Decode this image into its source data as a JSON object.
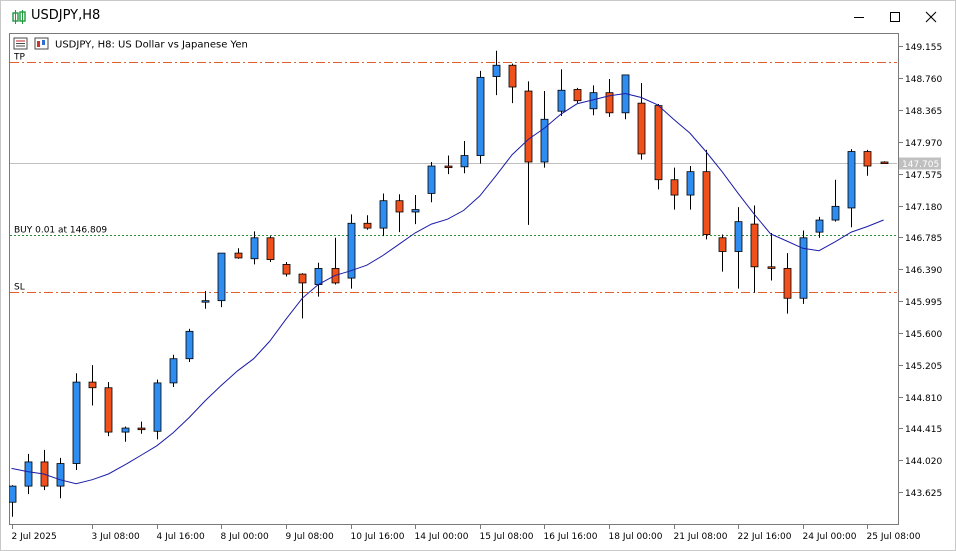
{
  "window": {
    "title": "USDJPY,H8"
  },
  "chart_header": {
    "text": "USDJPY, H8:  US Dollar vs Japanese Yen"
  },
  "levels": {
    "tp_label": "TP",
    "tp_price": 148.96,
    "buy_label": "BUY 0.01 at 146.809",
    "buy_price": 146.809,
    "sl_label": "SL",
    "sl_price": 146.11,
    "current_price_label": "147.705",
    "current_price": 147.705
  },
  "colors": {
    "bull": "#2f8cf0",
    "bear": "#f0501c",
    "ma": "#1c1ca8",
    "tp_sl_line": "#e0602a",
    "buy_line": "#2e8b3a",
    "grid": "#e8e8e8"
  },
  "chart_data": {
    "type": "candlestick",
    "symbol": "USDJPY",
    "timeframe": "H8",
    "ylim": [
      143.23,
      149.32
    ],
    "y_ticks": [
      "149.155",
      "148.760",
      "148.365",
      "147.970",
      "147.575",
      "147.180",
      "146.785",
      "146.390",
      "145.995",
      "145.600",
      "145.205",
      "144.810",
      "144.415",
      "144.020",
      "143.625"
    ],
    "x_ticks": [
      {
        "index": 0,
        "label": "2 Jul 2025"
      },
      {
        "index": 5,
        "label": "3 Jul 08:00"
      },
      {
        "index": 9,
        "label": "4 Jul 16:00"
      },
      {
        "index": 13,
        "label": "8 Jul 00:00"
      },
      {
        "index": 17,
        "label": "9 Jul 08:00"
      },
      {
        "index": 21,
        "label": "10 Jul 16:00"
      },
      {
        "index": 25,
        "label": "14 Jul 00:00"
      },
      {
        "index": 29,
        "label": "15 Jul 08:00"
      },
      {
        "index": 33,
        "label": "16 Jul 16:00"
      },
      {
        "index": 37,
        "label": "18 Jul 00:00"
      },
      {
        "index": 41,
        "label": "21 Jul 08:00"
      },
      {
        "index": 45,
        "label": "22 Jul 16:00"
      },
      {
        "index": 49,
        "label": "24 Jul 00:00"
      },
      {
        "index": 53,
        "label": "25 Jul 08:00"
      }
    ],
    "candles": [
      {
        "o": 143.5,
        "h": 143.71,
        "l": 143.32,
        "c": 143.7
      },
      {
        "o": 143.7,
        "h": 144.1,
        "l": 143.6,
        "c": 144.0
      },
      {
        "o": 144.0,
        "h": 144.15,
        "l": 143.65,
        "c": 143.7
      },
      {
        "o": 143.7,
        "h": 144.05,
        "l": 143.55,
        "c": 143.98
      },
      {
        "o": 143.98,
        "h": 145.1,
        "l": 143.9,
        "c": 144.99
      },
      {
        "o": 144.99,
        "h": 145.2,
        "l": 144.7,
        "c": 144.92
      },
      {
        "o": 144.92,
        "h": 144.99,
        "l": 144.32,
        "c": 144.37
      },
      {
        "o": 144.37,
        "h": 144.44,
        "l": 144.25,
        "c": 144.42
      },
      {
        "o": 144.42,
        "h": 144.5,
        "l": 144.35,
        "c": 144.4
      },
      {
        "o": 144.38,
        "h": 145.02,
        "l": 144.28,
        "c": 144.98
      },
      {
        "o": 144.98,
        "h": 145.33,
        "l": 144.93,
        "c": 145.28
      },
      {
        "o": 145.28,
        "h": 145.65,
        "l": 145.24,
        "c": 145.62
      },
      {
        "o": 145.99,
        "h": 146.12,
        "l": 145.9,
        "c": 146.0
      },
      {
        "o": 146.0,
        "h": 146.4,
        "l": 145.92,
        "c": 146.59
      },
      {
        "o": 146.59,
        "h": 146.65,
        "l": 146.52,
        "c": 146.53
      },
      {
        "o": 146.52,
        "h": 146.86,
        "l": 146.45,
        "c": 146.78
      },
      {
        "o": 146.78,
        "h": 146.8,
        "l": 146.48,
        "c": 146.51
      },
      {
        "o": 146.45,
        "h": 146.48,
        "l": 146.3,
        "c": 146.33
      },
      {
        "o": 146.33,
        "h": 146.34,
        "l": 145.78,
        "c": 146.22
      },
      {
        "o": 146.2,
        "h": 146.47,
        "l": 146.05,
        "c": 146.4
      },
      {
        "o": 146.4,
        "h": 146.78,
        "l": 146.2,
        "c": 146.22
      },
      {
        "o": 146.28,
        "h": 147.07,
        "l": 146.15,
        "c": 146.96
      },
      {
        "o": 146.96,
        "h": 147.06,
        "l": 146.88,
        "c": 146.9
      },
      {
        "o": 146.9,
        "h": 147.33,
        "l": 146.8,
        "c": 147.24
      },
      {
        "o": 147.24,
        "h": 147.32,
        "l": 146.85,
        "c": 147.1
      },
      {
        "o": 147.1,
        "h": 147.31,
        "l": 146.95,
        "c": 147.13
      },
      {
        "o": 147.33,
        "h": 147.72,
        "l": 147.22,
        "c": 147.67
      },
      {
        "o": 147.67,
        "h": 147.8,
        "l": 147.57,
        "c": 147.65
      },
      {
        "o": 147.66,
        "h": 147.98,
        "l": 147.58,
        "c": 147.8
      },
      {
        "o": 147.8,
        "h": 148.85,
        "l": 147.7,
        "c": 148.77
      },
      {
        "o": 148.78,
        "h": 149.1,
        "l": 148.55,
        "c": 148.92
      },
      {
        "o": 148.92,
        "h": 148.94,
        "l": 148.45,
        "c": 148.65
      },
      {
        "o": 148.6,
        "h": 148.72,
        "l": 146.94,
        "c": 147.72
      },
      {
        "o": 147.72,
        "h": 148.6,
        "l": 147.65,
        "c": 148.25
      },
      {
        "o": 148.35,
        "h": 148.87,
        "l": 148.29,
        "c": 148.61
      },
      {
        "o": 148.62,
        "h": 148.64,
        "l": 148.45,
        "c": 148.48
      },
      {
        "o": 148.38,
        "h": 148.67,
        "l": 148.3,
        "c": 148.58
      },
      {
        "o": 148.58,
        "h": 148.75,
        "l": 148.28,
        "c": 148.33
      },
      {
        "o": 148.33,
        "h": 148.8,
        "l": 148.25,
        "c": 148.8
      },
      {
        "o": 148.45,
        "h": 148.7,
        "l": 147.75,
        "c": 147.82
      },
      {
        "o": 148.42,
        "h": 148.44,
        "l": 147.38,
        "c": 147.5
      },
      {
        "o": 147.5,
        "h": 147.65,
        "l": 147.13,
        "c": 147.31
      },
      {
        "o": 147.31,
        "h": 147.67,
        "l": 147.13,
        "c": 147.6
      },
      {
        "o": 147.6,
        "h": 147.87,
        "l": 146.76,
        "c": 146.82
      },
      {
        "o": 146.78,
        "h": 146.82,
        "l": 146.36,
        "c": 146.61
      },
      {
        "o": 146.61,
        "h": 147.16,
        "l": 146.15,
        "c": 146.98
      },
      {
        "o": 146.95,
        "h": 147.18,
        "l": 146.1,
        "c": 146.42
      },
      {
        "o": 146.42,
        "h": 146.84,
        "l": 146.25,
        "c": 146.4
      },
      {
        "o": 146.4,
        "h": 146.59,
        "l": 145.84,
        "c": 146.03
      },
      {
        "o": 146.03,
        "h": 146.87,
        "l": 145.96,
        "c": 146.78
      },
      {
        "o": 146.85,
        "h": 147.04,
        "l": 146.78,
        "c": 147.0
      },
      {
        "o": 147.0,
        "h": 147.5,
        "l": 146.98,
        "c": 147.17
      },
      {
        "o": 147.15,
        "h": 147.88,
        "l": 146.91,
        "c": 147.85
      },
      {
        "o": 147.85,
        "h": 147.87,
        "l": 147.55,
        "c": 147.67
      },
      {
        "o": 147.72,
        "h": 147.73,
        "l": 147.7,
        "c": 147.7
      }
    ],
    "ma": [
      143.92,
      143.88,
      143.85,
      143.78,
      143.73,
      143.78,
      143.85,
      143.96,
      144.08,
      144.2,
      144.36,
      144.55,
      144.76,
      144.95,
      145.13,
      145.28,
      145.5,
      145.77,
      146.03,
      146.2,
      146.31,
      146.37,
      146.44,
      146.56,
      146.7,
      146.84,
      146.95,
      147.01,
      147.12,
      147.3,
      147.55,
      147.81,
      148.0,
      148.14,
      148.31,
      148.44,
      148.49,
      148.54,
      148.57,
      148.52,
      148.43,
      148.25,
      148.08,
      147.85,
      147.6,
      147.33,
      147.07,
      146.83,
      146.74,
      146.65,
      146.62,
      146.73,
      146.85,
      146.92,
      147.0
    ]
  }
}
